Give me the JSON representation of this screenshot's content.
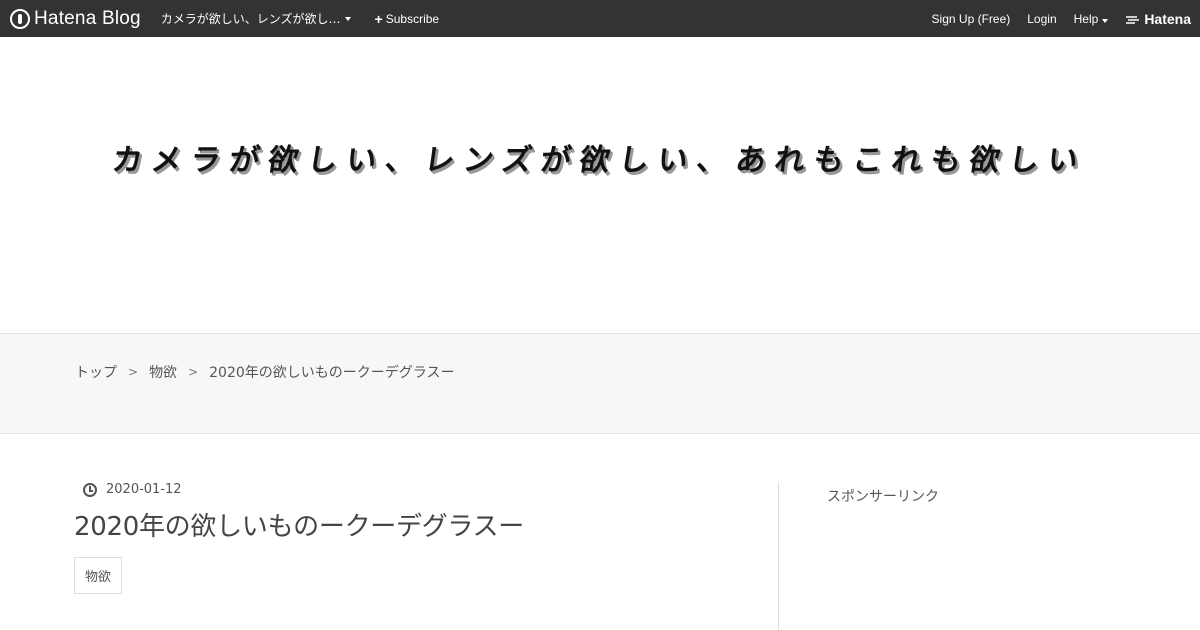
{
  "globalbar": {
    "logo_text": "Hatena Blog",
    "blog_name": "カメラが欲しい、レンズが欲し…",
    "subscribe_label": "Subscribe",
    "signup_label": "Sign Up (Free)",
    "login_label": "Login",
    "help_label": "Help",
    "hatena_label": "Hatena"
  },
  "header": {
    "title": "カメラが欲しい、レンズが欲しい、あれもこれも欲しい"
  },
  "breadcrumb": {
    "items": [
      "トップ",
      "物欲",
      "2020年の欲しいものークーデグラスー"
    ],
    "separator": ">"
  },
  "entry": {
    "date": "2020-01-12",
    "title": "2020年の欲しいものークーデグラスー",
    "category": "物欲"
  },
  "sidebar": {
    "title": "スポンサーリンク"
  },
  "colors": {
    "globalbar_bg": "#333333",
    "crumb_band_bg": "#f7f7f7"
  }
}
